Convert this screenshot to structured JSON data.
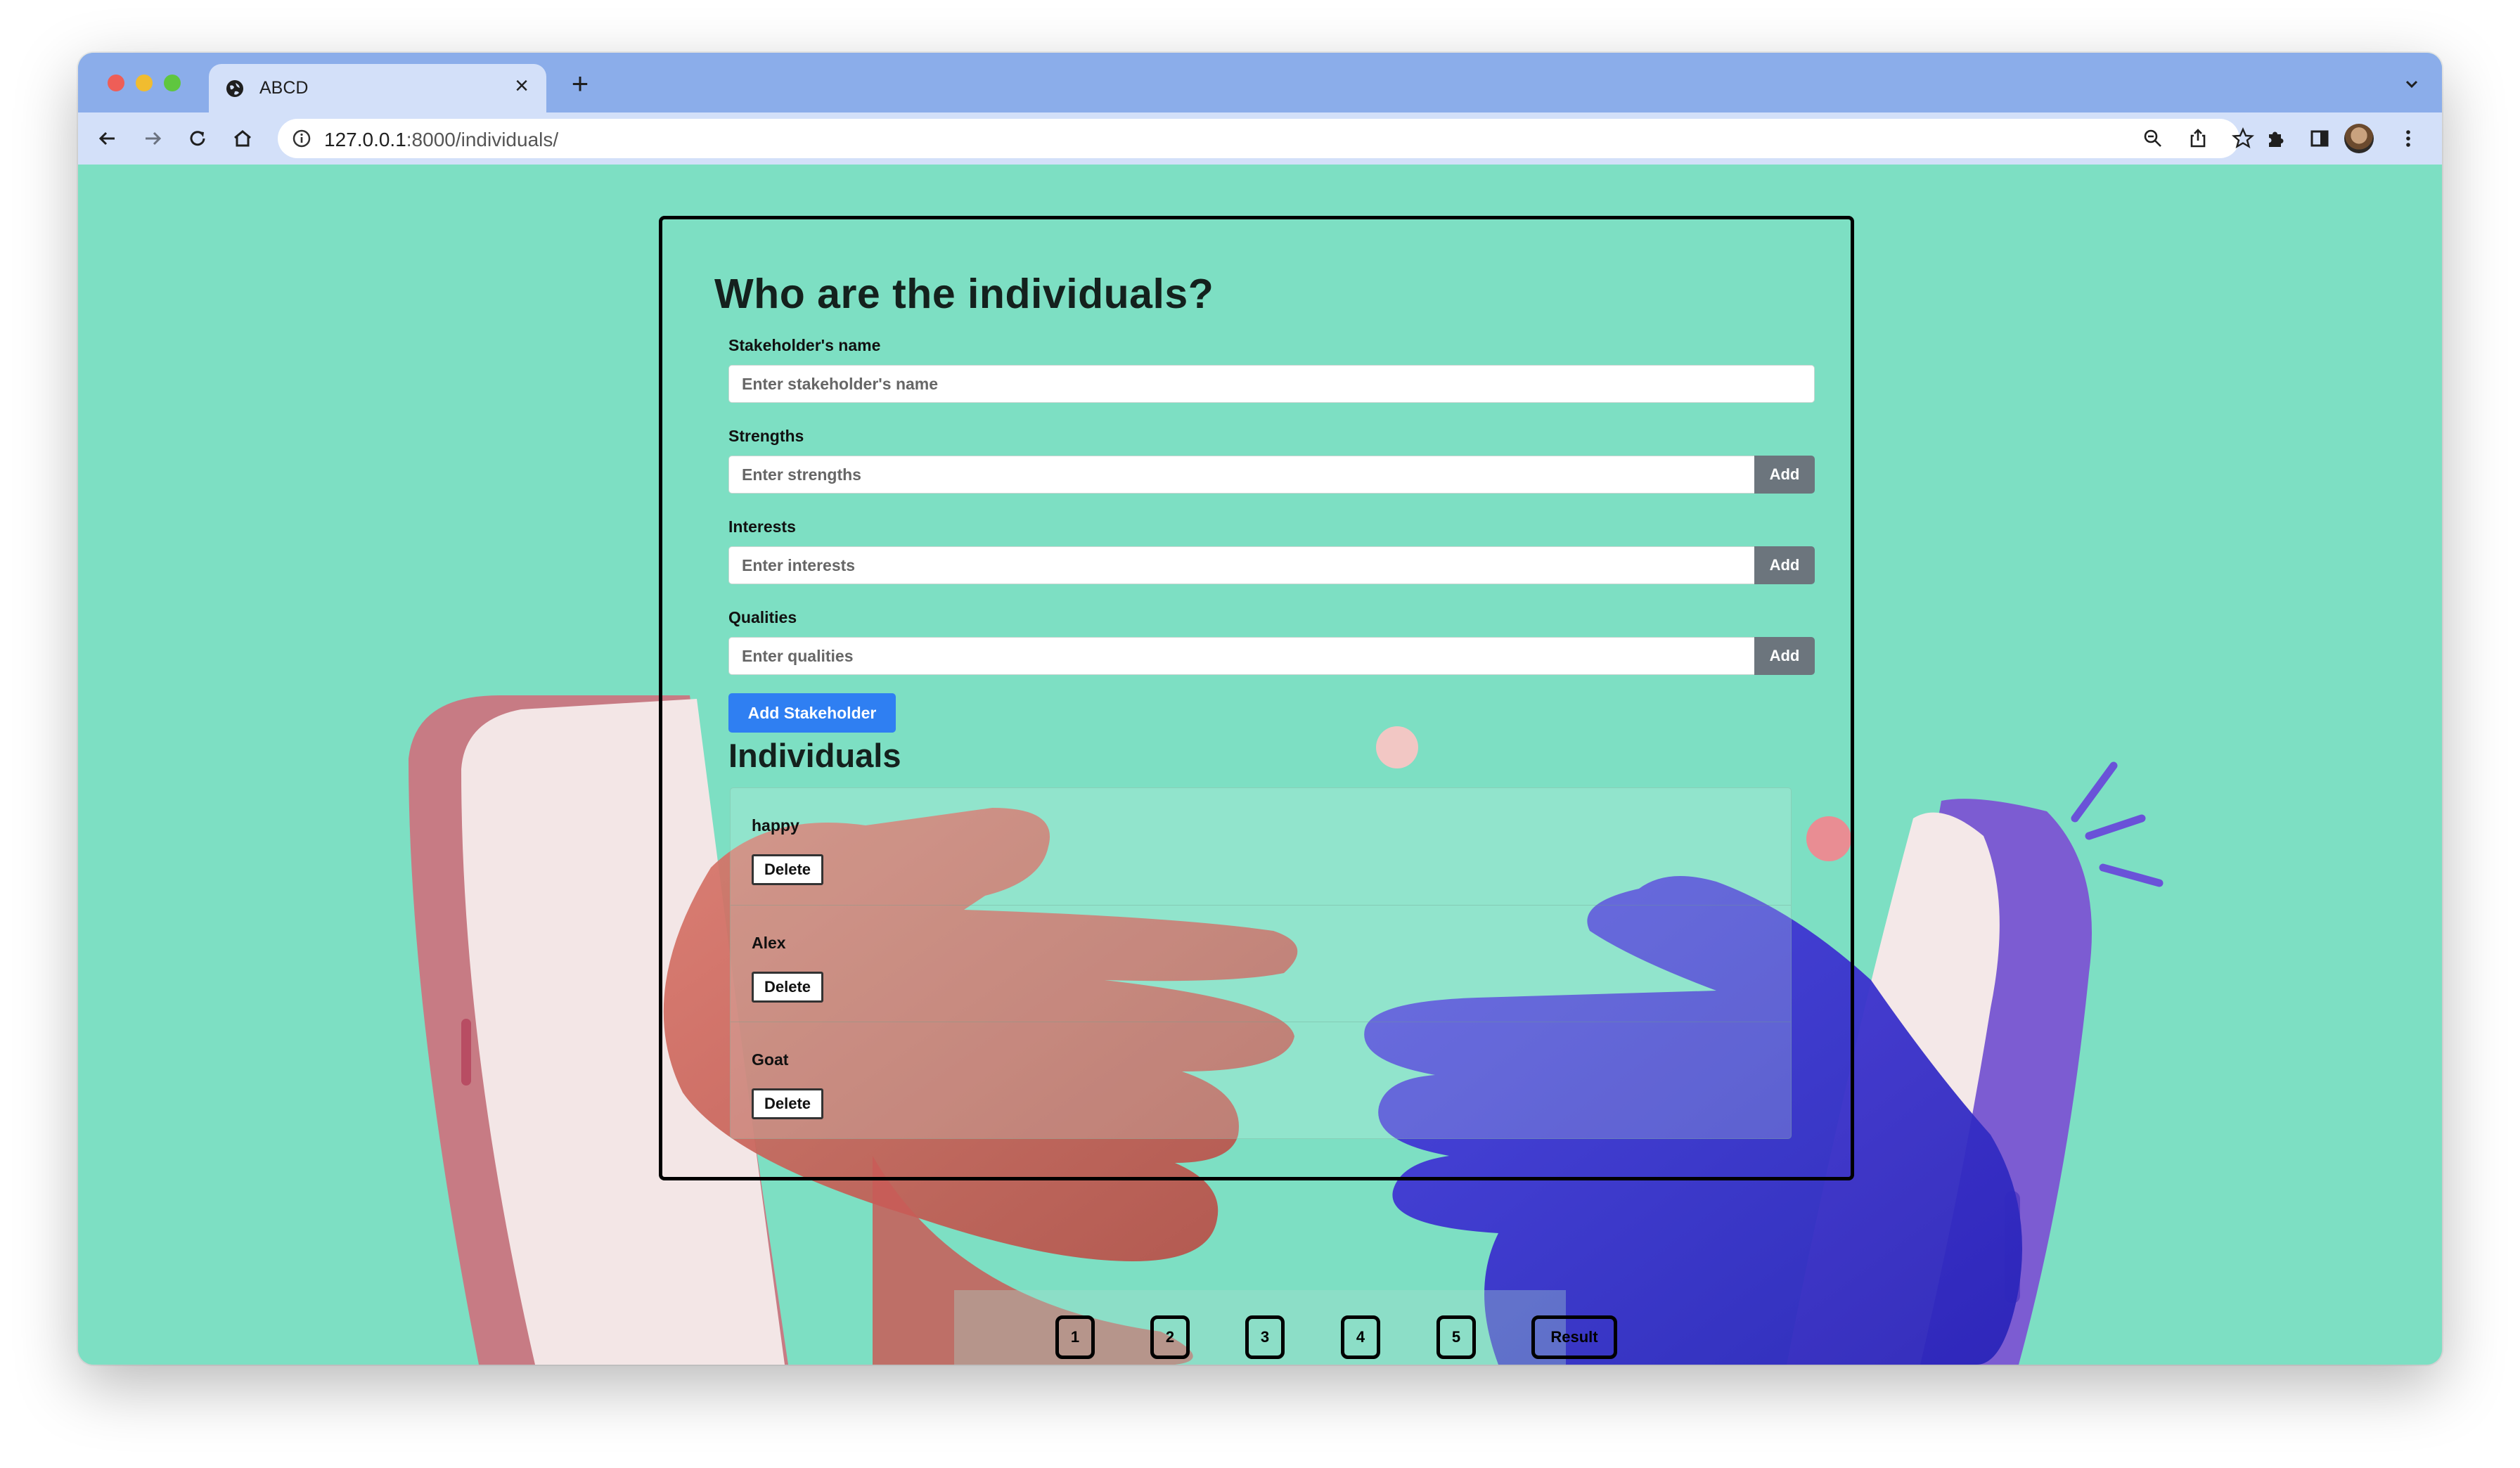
{
  "browser": {
    "tab_title": "ABCD",
    "url_host": "127.0.0.1",
    "url_path": ":8000/individuals/",
    "new_tab_icon": "plus-icon",
    "icons": [
      "back-arrow-icon",
      "forward-arrow-icon",
      "reload-icon",
      "home-icon",
      "info-icon",
      "zoom-icon",
      "share-icon",
      "star-icon",
      "extensions-icon",
      "sidepanel-icon",
      "avatar",
      "kebab-menu-icon"
    ]
  },
  "form": {
    "title": "Who are the individuals?",
    "name_label": "Stakeholder's name",
    "name_placeholder": "Enter stakeholder's name",
    "strengths_label": "Strengths",
    "strengths_placeholder": "Enter strengths",
    "interests_label": "Interests",
    "interests_placeholder": "Enter interests",
    "qualities_label": "Qualities",
    "qualities_placeholder": "Enter qualities",
    "add_label": "Add",
    "add_stakeholder_label": "Add Stakeholder"
  },
  "individuals": {
    "title": "Individuals",
    "delete_label": "Delete",
    "items": [
      {
        "name": "happy"
      },
      {
        "name": "Alex"
      },
      {
        "name": "Goat"
      }
    ]
  },
  "pagination": {
    "pages": [
      "1",
      "2",
      "3",
      "4",
      "5"
    ],
    "result_label": "Result"
  },
  "colors": {
    "background": "#7ddfc3",
    "primary": "#2f7ff2",
    "secondary": "#6c757d",
    "tabstrip": "#8badea"
  }
}
